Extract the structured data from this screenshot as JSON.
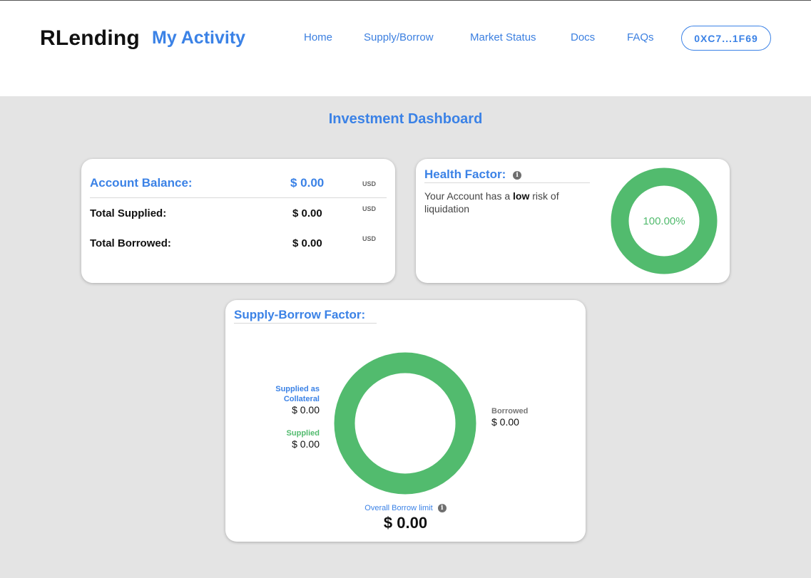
{
  "header": {
    "brand": "RLending",
    "section": "My Activity",
    "nav": [
      "Home",
      "Supply/Borrow",
      "Market Status",
      "Docs",
      "FAQs"
    ],
    "wallet": "0XC7...1F69"
  },
  "dashboard": {
    "title": "Investment Dashboard"
  },
  "balance_card": {
    "account_balance_label": "Account Balance:",
    "account_balance_value": "$ 0.00",
    "account_balance_unit": "USD",
    "total_supplied_label": "Total Supplied:",
    "total_supplied_value": "$ 0.00",
    "total_supplied_unit": "USD",
    "total_borrowed_label": "Total Borrowed:",
    "total_borrowed_value": "$ 0.00",
    "total_borrowed_unit": "USD"
  },
  "health_card": {
    "title": "Health Factor:",
    "text_prefix": "Your Account has a ",
    "risk_level": "low",
    "text_suffix": " risk of liquidation",
    "percent": "100.00%",
    "fill_fraction": 1.0,
    "color": "#52bb6e"
  },
  "sbf_card": {
    "title": "Supply-Borrow Factor:",
    "collateral_label": "Supplied as Collateral",
    "collateral_value": "$ 0.00",
    "supplied_label": "Supplied",
    "supplied_value": "$ 0.00",
    "borrowed_label": "Borrowed",
    "borrowed_value": "$ 0.00",
    "limit_label": "Overall Borrow limit",
    "limit_value": "$ 0.00",
    "ring_color": "#52bb6e"
  },
  "colors": {
    "accent": "#3b82e6",
    "green": "#52bb6e",
    "background": "#e4e4e4"
  }
}
